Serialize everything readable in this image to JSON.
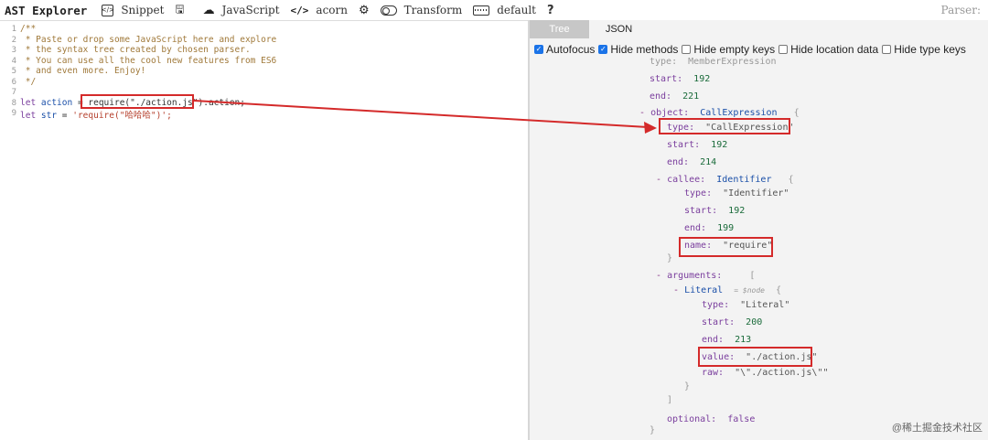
{
  "toolbar": {
    "brand": "AST Explorer",
    "snippet": "Snippet",
    "language": "JavaScript",
    "parser": "acorn",
    "transform": "Transform",
    "transform_default": "default",
    "help": "?",
    "parser_label": "Parser:"
  },
  "editor": {
    "lines": [
      {
        "n": "1",
        "text": "/**"
      },
      {
        "n": "2",
        "text": " * Paste or drop some JavaScript here and explore"
      },
      {
        "n": "3",
        "text": " * the syntax tree created by chosen parser."
      },
      {
        "n": "4",
        "text": " * You can use all the cool new features from ES6"
      },
      {
        "n": "5",
        "text": " * and even more. Enjoy!"
      },
      {
        "n": "6",
        "text": " */"
      },
      {
        "n": "7",
        "text": ""
      },
      {
        "n": "8",
        "text": ""
      },
      {
        "n": "9",
        "text": ""
      }
    ],
    "line8": {
      "kw": "let ",
      "var": "action",
      "eq": " = ",
      "call": "require(\"./action.js\")",
      "rest": ".action;"
    },
    "line9": {
      "kw": "let ",
      "var": "str",
      "eq": " = ",
      "str": "'require(\"哈哈哈\")';"
    }
  },
  "pane": {
    "tabs": [
      "Tree",
      "JSON"
    ],
    "options": [
      {
        "label": "Autofocus",
        "checked": true
      },
      {
        "label": "Hide methods",
        "checked": true
      },
      {
        "label": "Hide empty keys",
        "checked": false
      },
      {
        "label": "Hide location data",
        "checked": false
      },
      {
        "label": "Hide type keys",
        "checked": false
      }
    ],
    "tree": {
      "l0": {
        "k": "type:",
        "v": "MemberExpression"
      },
      "l1": {
        "k": "start:",
        "v": "192"
      },
      "l2": {
        "k": "end:",
        "v": "221"
      },
      "l3": {
        "m": "-",
        "k": "object:",
        "v": "CallExpression",
        "b": "{"
      },
      "l4": {
        "k": "type:",
        "v": "\"CallExpression\""
      },
      "l5": {
        "k": "start:",
        "v": "192"
      },
      "l6": {
        "k": "end:",
        "v": "214"
      },
      "l7": {
        "m": "-",
        "k": "callee:",
        "v": "Identifier",
        "b": "{"
      },
      "l8": {
        "k": "type:",
        "v": "\"Identifier\""
      },
      "l9": {
        "k": "start:",
        "v": "192"
      },
      "l10": {
        "k": "end:",
        "v": "199"
      },
      "l11": {
        "k": "name:",
        "v": "\"require\""
      },
      "l12": {
        "b": "}"
      },
      "l13": {
        "m": "-",
        "k": "arguments:",
        "b": "["
      },
      "l14": {
        "m": "-",
        "v": "Literal",
        "note": "= $node",
        "b": "{"
      },
      "l15": {
        "k": "type:",
        "v": "\"Literal\""
      },
      "l16": {
        "k": "start:",
        "v": "200"
      },
      "l17": {
        "k": "end:",
        "v": "213"
      },
      "l18": {
        "k": "value:",
        "v": "\"./action.js\""
      },
      "l19": {
        "k": "raw:",
        "v": "\"\\\"./action.js\\\"\""
      },
      "l20": {
        "b": "}"
      },
      "l21": {
        "b": "]"
      },
      "l22": {
        "k": "optional:",
        "v": "false"
      },
      "l23": {
        "b": "}"
      }
    }
  },
  "watermark": "@稀土掘金技术社区",
  "colors": {
    "highlight": "#d42a2a",
    "accent": "#1a73e8"
  }
}
